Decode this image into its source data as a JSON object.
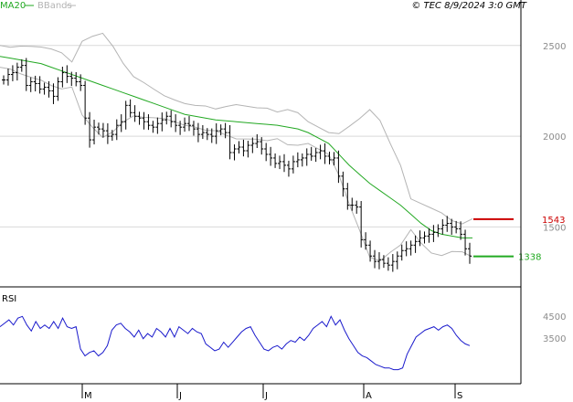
{
  "header": {
    "ma_label": "MA20",
    "bbands_label": "BBands",
    "copyright": "© TEC 8/9/2024 3:0 GMT"
  },
  "colors": {
    "ma": "#22a822",
    "bands": "#b4b4b4",
    "price": "#000000",
    "rsi": "#1a1acc",
    "resistance": "#cc0000",
    "support": "#22aa22",
    "grid": "#d9d9d9"
  },
  "chart_data": [
    {
      "type": "ohlc",
      "panel": "price",
      "legend": [
        "MA20",
        "BBands"
      ],
      "y_ticks": [
        2500,
        2000,
        1500
      ],
      "ylim": [
        1170,
        2680
      ],
      "x_labels": [
        "M",
        "J",
        "J",
        "A",
        "S"
      ],
      "close": [
        2310,
        2340,
        2350,
        2380,
        2390,
        2280,
        2300,
        2290,
        2260,
        2270,
        2250,
        2220,
        2300,
        2350,
        2330,
        2320,
        2300,
        2280,
        2100,
        1980,
        2050,
        2040,
        2030,
        2000,
        2010,
        2060,
        2080,
        2170,
        2130,
        2110,
        2100,
        2080,
        2060,
        2050,
        2070,
        2090,
        2110,
        2080,
        2060,
        2050,
        2070,
        2060,
        2040,
        2010,
        2020,
        2010,
        2000,
        2030,
        2040,
        2020,
        1910,
        1930,
        1940,
        1920,
        1950,
        1960,
        1970,
        1930,
        1900,
        1880,
        1850,
        1860,
        1840,
        1820,
        1860,
        1870,
        1880,
        1900,
        1890,
        1910,
        1920,
        1890,
        1870,
        1880,
        1780,
        1710,
        1620,
        1620,
        1610,
        1430,
        1400,
        1340,
        1310,
        1320,
        1300,
        1290,
        1310,
        1340,
        1370,
        1380,
        1400,
        1420,
        1440,
        1450,
        1460,
        1470,
        1490,
        1510,
        1520,
        1500,
        1490,
        1460,
        1380,
        1340
      ],
      "ma20": [
        2440,
        2430,
        2420,
        2410,
        2400,
        2380,
        2360,
        2340,
        2320,
        2300,
        2280,
        2260,
        2240,
        2220,
        2200,
        2180,
        2160,
        2140,
        2120,
        2110,
        2100,
        2090,
        2085,
        2080,
        2075,
        2070,
        2065,
        2060,
        2050,
        2040,
        2020,
        1990,
        1960,
        1900,
        1840,
        1790,
        1740,
        1700,
        1660,
        1620,
        1570,
        1520,
        1480,
        1460,
        1450,
        1440,
        1440
      ],
      "resistance": 1543,
      "support": 1338
    },
    {
      "type": "line",
      "panel": "rsi",
      "label": "RSI",
      "y_ticks": [
        4500,
        3500
      ],
      "values": [
        60,
        64,
        68,
        62,
        70,
        72,
        62,
        55,
        66,
        58,
        62,
        58,
        66,
        58,
        70,
        60,
        58,
        60,
        34,
        26,
        30,
        32,
        26,
        30,
        38,
        56,
        62,
        64,
        58,
        54,
        48,
        56,
        46,
        52,
        48,
        58,
        54,
        48,
        58,
        48,
        60,
        56,
        52,
        58,
        54,
        52,
        40,
        36,
        32,
        34,
        42,
        36,
        42,
        48,
        54,
        58,
        60,
        50,
        42,
        34,
        32,
        36,
        38,
        34,
        40,
        44,
        42,
        48,
        44,
        50,
        58,
        62,
        66,
        60,
        72,
        62,
        68,
        56,
        46,
        38,
        30,
        26,
        24,
        20,
        16,
        14,
        12,
        12,
        10,
        10,
        12,
        28,
        38,
        48,
        52,
        56,
        58,
        60,
        56,
        60,
        62,
        58,
        50,
        44,
        40,
        38
      ]
    }
  ]
}
